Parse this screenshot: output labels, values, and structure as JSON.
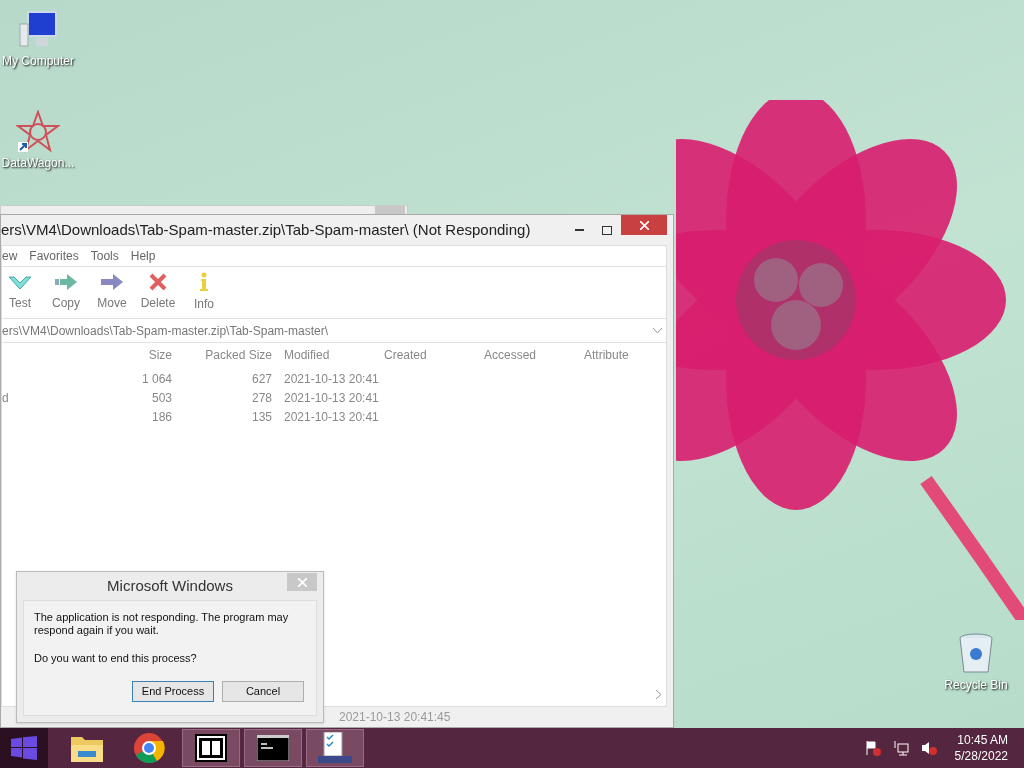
{
  "desktop_icons": [
    {
      "label": "My Computer",
      "kind": "computer"
    },
    {
      "label": "DataWagon...",
      "kind": "shortcut"
    },
    {
      "label": "Recycle Bin",
      "kind": "bin"
    }
  ],
  "window": {
    "title": "ers\\VM4\\Downloads\\Tab-Spam-master.zip\\Tab-Spam-master\\ (Not Responding)",
    "menu": [
      "ew",
      "Favorites",
      "Tools",
      "Help"
    ],
    "toolbar": [
      {
        "label": "Test",
        "kind": "test"
      },
      {
        "label": "Copy",
        "kind": "copy"
      },
      {
        "label": "Move",
        "kind": "move"
      },
      {
        "label": "Delete",
        "kind": "delete"
      },
      {
        "label": "Info",
        "kind": "info"
      }
    ],
    "address": "ers\\VM4\\Downloads\\Tab-Spam-master.zip\\Tab-Spam-master\\",
    "columns": [
      "Size",
      "Packed Size",
      "Modified",
      "Created",
      "Accessed",
      "Attribute"
    ],
    "rows": [
      {
        "name": "",
        "size": "1 064",
        "packed": "627",
        "modified": "2021-10-13 20:41"
      },
      {
        "name": "d",
        "size": "503",
        "packed": "278",
        "modified": "2021-10-13 20:41"
      },
      {
        "name": "",
        "size": "186",
        "packed": "135",
        "modified": "2021-10-13 20:41"
      }
    ],
    "status_bar": "2021-10-13 20:41:45"
  },
  "dialog": {
    "title": "Microsoft Windows",
    "message": "The application is not responding. The program may respond again if you wait.",
    "question": "Do you want to end this process?",
    "buttons": [
      {
        "label": "End Process",
        "selected": true
      },
      {
        "label": "Cancel",
        "selected": false
      }
    ]
  },
  "taskbar": {
    "apps": [
      {
        "kind": "explorer",
        "active": false
      },
      {
        "kind": "chrome",
        "active": false
      },
      {
        "kind": "sevenzip",
        "active": true
      },
      {
        "kind": "console",
        "active": true
      },
      {
        "kind": "tasks",
        "active": true
      }
    ],
    "time": "10:45 AM",
    "date": "5/28/2022"
  }
}
